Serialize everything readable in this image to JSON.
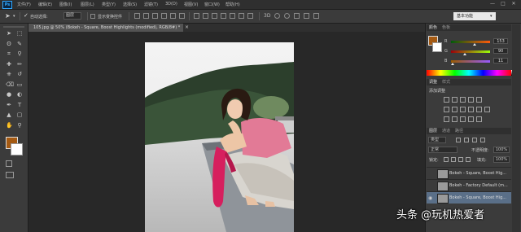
{
  "app": {
    "logo_text": "Ps",
    "menus": [
      "文件(F)",
      "编辑(E)",
      "图像(I)",
      "图层(L)",
      "类型(Y)",
      "选择(S)",
      "滤镜(T)",
      "3D(D)",
      "视图(V)",
      "窗口(W)",
      "帮助(H)"
    ],
    "window_controls": [
      "—",
      "□",
      "✕"
    ]
  },
  "options_bar": {
    "auto_select_label": "自动选择:",
    "auto_select_value": "图层",
    "show_transform_label": "显示变换控件",
    "workspace": "基本功能"
  },
  "document": {
    "tab_title": "105.jpg @ 50% (Bokeh - Square, Boost Highlights (modified), RGB/8#) *",
    "close": "×"
  },
  "colors": {
    "foreground": "#a55a12",
    "background": "#ffffff",
    "selected_layer": "#5a6f88",
    "accent_blue": "#31a8ff"
  },
  "color_panel": {
    "tabs": [
      "颜色",
      "色板"
    ],
    "channels": [
      {
        "name": "R",
        "value": "153",
        "level": 0.6
      },
      {
        "name": "G",
        "value": "90",
        "level": 0.35
      },
      {
        "name": "B",
        "value": "11",
        "level": 0.04
      }
    ]
  },
  "adjustments_panel": {
    "tabs": [
      "调整",
      "样式"
    ],
    "subtitle": "添加调整"
  },
  "layers_panel": {
    "tabs": [
      "图层",
      "通道",
      "路径"
    ],
    "kind_filter": "类型",
    "blend_mode": "正常",
    "opacity_label": "不透明度:",
    "opacity_value": "100%",
    "lock_label": "锁定:",
    "fill_label": "填充:",
    "fill_value": "100%",
    "layers": [
      {
        "name": "Bokeh - Square, Boost Hig...",
        "visible": false,
        "selected": false
      },
      {
        "name": "Bokeh - Factory Default (m...",
        "visible": false,
        "selected": false
      },
      {
        "name": "Bokeh - Square, Boost Hig...",
        "visible": true,
        "selected": true
      }
    ]
  },
  "tools": [
    "move-tool",
    "marquee-tool",
    "lasso-tool",
    "quick-select-tool",
    "crop-tool",
    "eyedropper-tool",
    "healing-brush-tool",
    "brush-tool",
    "clone-stamp-tool",
    "history-brush-tool",
    "eraser-tool",
    "gradient-tool",
    "blur-tool",
    "dodge-tool",
    "pen-tool",
    "type-tool",
    "path-select-tool",
    "shape-tool",
    "hand-tool",
    "zoom-tool"
  ],
  "watermark": "头条 @玩机热爱者"
}
